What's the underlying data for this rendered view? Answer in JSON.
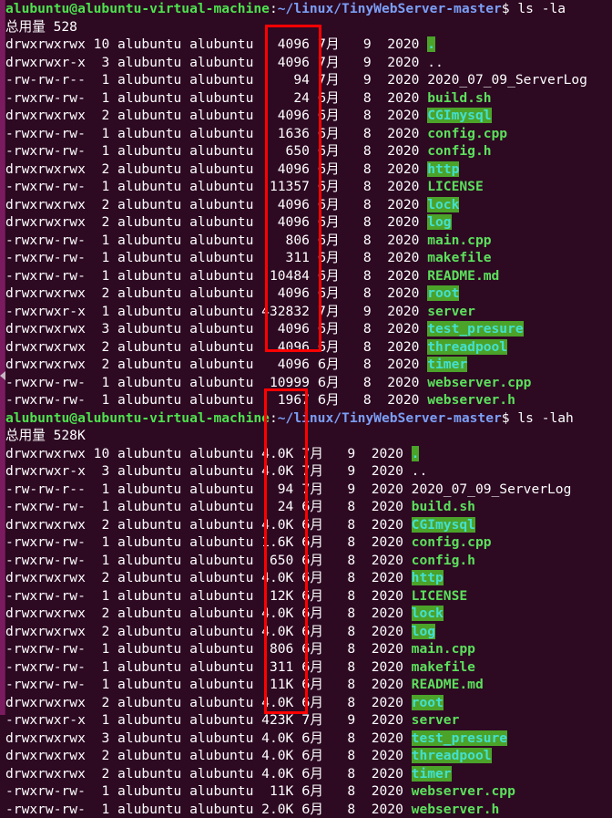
{
  "terminal": {
    "background_color": "#2d0922",
    "prompt": {
      "user_host": "alubuntu@alubuntu-virtual-machine",
      "separator": ":",
      "path": "~/linux/TinyWebServer-master",
      "sigil": "$"
    },
    "colors": {
      "prompt_user": "#4ee24e",
      "prompt_path": "#7b9ff5",
      "directory_fg": "#43e0d0",
      "directory_bg": "#4ba32a",
      "executable": "#5ce05c",
      "source_file": "#5ce05c",
      "plain_text": "#ffffff",
      "annotation_box": "#ff0000"
    },
    "sessions": [
      {
        "command": "ls -la",
        "total_label": "总用量",
        "total_value": "528",
        "rows": [
          {
            "perm": "drwxrwxrwx",
            "links": "10",
            "owner": "alubuntu",
            "group": "alubuntu",
            "size": "4096",
            "month": "7月",
            "day": "9",
            "year": "2020",
            "name": ".",
            "type": "dir"
          },
          {
            "perm": "drwxrwxr-x",
            "links": "3",
            "owner": "alubuntu",
            "group": "alubuntu",
            "size": "4096",
            "month": "7月",
            "day": "9",
            "year": "2020",
            "name": "..",
            "type": "dotdot"
          },
          {
            "perm": "-rw-rw-r--",
            "links": "1",
            "owner": "alubuntu",
            "group": "alubuntu",
            "size": "94",
            "month": "7月",
            "day": "9",
            "year": "2020",
            "name": "2020_07_09_ServerLog",
            "type": "file"
          },
          {
            "perm": "-rwxrw-rw-",
            "links": "1",
            "owner": "alubuntu",
            "group": "alubuntu",
            "size": "24",
            "month": "6月",
            "day": "8",
            "year": "2020",
            "name": "build.sh",
            "type": "src"
          },
          {
            "perm": "drwxrwxrwx",
            "links": "2",
            "owner": "alubuntu",
            "group": "alubuntu",
            "size": "4096",
            "month": "6月",
            "day": "8",
            "year": "2020",
            "name": "CGImysql",
            "type": "dir"
          },
          {
            "perm": "-rwxrw-rw-",
            "links": "1",
            "owner": "alubuntu",
            "group": "alubuntu",
            "size": "1636",
            "month": "6月",
            "day": "8",
            "year": "2020",
            "name": "config.cpp",
            "type": "src"
          },
          {
            "perm": "-rwxrw-rw-",
            "links": "1",
            "owner": "alubuntu",
            "group": "alubuntu",
            "size": "650",
            "month": "6月",
            "day": "8",
            "year": "2020",
            "name": "config.h",
            "type": "src"
          },
          {
            "perm": "drwxrwxrwx",
            "links": "2",
            "owner": "alubuntu",
            "group": "alubuntu",
            "size": "4096",
            "month": "6月",
            "day": "8",
            "year": "2020",
            "name": "http",
            "type": "dir"
          },
          {
            "perm": "-rwxrw-rw-",
            "links": "1",
            "owner": "alubuntu",
            "group": "alubuntu",
            "size": "11357",
            "month": "6月",
            "day": "8",
            "year": "2020",
            "name": "LICENSE",
            "type": "src"
          },
          {
            "perm": "drwxrwxrwx",
            "links": "2",
            "owner": "alubuntu",
            "group": "alubuntu",
            "size": "4096",
            "month": "6月",
            "day": "8",
            "year": "2020",
            "name": "lock",
            "type": "dir"
          },
          {
            "perm": "drwxrwxrwx",
            "links": "2",
            "owner": "alubuntu",
            "group": "alubuntu",
            "size": "4096",
            "month": "6月",
            "day": "8",
            "year": "2020",
            "name": "log",
            "type": "dir"
          },
          {
            "perm": "-rwxrw-rw-",
            "links": "1",
            "owner": "alubuntu",
            "group": "alubuntu",
            "size": "806",
            "month": "6月",
            "day": "8",
            "year": "2020",
            "name": "main.cpp",
            "type": "src"
          },
          {
            "perm": "-rwxrw-rw-",
            "links": "1",
            "owner": "alubuntu",
            "group": "alubuntu",
            "size": "311",
            "month": "6月",
            "day": "8",
            "year": "2020",
            "name": "makefile",
            "type": "src"
          },
          {
            "perm": "-rwxrw-rw-",
            "links": "1",
            "owner": "alubuntu",
            "group": "alubuntu",
            "size": "10484",
            "month": "6月",
            "day": "8",
            "year": "2020",
            "name": "README.md",
            "type": "src"
          },
          {
            "perm": "drwxrwxrwx",
            "links": "2",
            "owner": "alubuntu",
            "group": "alubuntu",
            "size": "4096",
            "month": "6月",
            "day": "8",
            "year": "2020",
            "name": "root",
            "type": "dir"
          },
          {
            "perm": "-rwxrwxr-x",
            "links": "1",
            "owner": "alubuntu",
            "group": "alubuntu",
            "size": "432832",
            "month": "7月",
            "day": "9",
            "year": "2020",
            "name": "server",
            "type": "exec"
          },
          {
            "perm": "drwxrwxrwx",
            "links": "3",
            "owner": "alubuntu",
            "group": "alubuntu",
            "size": "4096",
            "month": "6月",
            "day": "8",
            "year": "2020",
            "name": "test_presure",
            "type": "dir"
          },
          {
            "perm": "drwxrwxrwx",
            "links": "2",
            "owner": "alubuntu",
            "group": "alubuntu",
            "size": "4096",
            "month": "6月",
            "day": "8",
            "year": "2020",
            "name": "threadpool",
            "type": "dir"
          },
          {
            "perm": "drwxrwxrwx",
            "links": "2",
            "owner": "alubuntu",
            "group": "alubuntu",
            "size": "4096",
            "month": "6月",
            "day": "8",
            "year": "2020",
            "name": "timer",
            "type": "dir"
          },
          {
            "perm": "-rwxrw-rw-",
            "links": "1",
            "owner": "alubuntu",
            "group": "alubuntu",
            "size": "10999",
            "month": "6月",
            "day": "8",
            "year": "2020",
            "name": "webserver.cpp",
            "type": "src"
          },
          {
            "perm": "-rwxrw-rw-",
            "links": "1",
            "owner": "alubuntu",
            "group": "alubuntu",
            "size": "1967",
            "month": "6月",
            "day": "8",
            "year": "2020",
            "name": "webserver.h",
            "type": "src"
          }
        ]
      },
      {
        "command": "ls -lah",
        "total_label": "总用量",
        "total_value": "528K",
        "rows": [
          {
            "perm": "drwxrwxrwx",
            "links": "10",
            "owner": "alubuntu",
            "group": "alubuntu",
            "size": "4.0K",
            "month": "7月",
            "day": "9",
            "year": "2020",
            "name": ".",
            "type": "dir"
          },
          {
            "perm": "drwxrwxr-x",
            "links": "3",
            "owner": "alubuntu",
            "group": "alubuntu",
            "size": "4.0K",
            "month": "7月",
            "day": "9",
            "year": "2020",
            "name": "..",
            "type": "dotdot"
          },
          {
            "perm": "-rw-rw-r--",
            "links": "1",
            "owner": "alubuntu",
            "group": "alubuntu",
            "size": "94",
            "month": "7月",
            "day": "9",
            "year": "2020",
            "name": "2020_07_09_ServerLog",
            "type": "file"
          },
          {
            "perm": "-rwxrw-rw-",
            "links": "1",
            "owner": "alubuntu",
            "group": "alubuntu",
            "size": "24",
            "month": "6月",
            "day": "8",
            "year": "2020",
            "name": "build.sh",
            "type": "src"
          },
          {
            "perm": "drwxrwxrwx",
            "links": "2",
            "owner": "alubuntu",
            "group": "alubuntu",
            "size": "4.0K",
            "month": "6月",
            "day": "8",
            "year": "2020",
            "name": "CGImysql",
            "type": "dir"
          },
          {
            "perm": "-rwxrw-rw-",
            "links": "1",
            "owner": "alubuntu",
            "group": "alubuntu",
            "size": "1.6K",
            "month": "6月",
            "day": "8",
            "year": "2020",
            "name": "config.cpp",
            "type": "src"
          },
          {
            "perm": "-rwxrw-rw-",
            "links": "1",
            "owner": "alubuntu",
            "group": "alubuntu",
            "size": "650",
            "month": "6月",
            "day": "8",
            "year": "2020",
            "name": "config.h",
            "type": "src"
          },
          {
            "perm": "drwxrwxrwx",
            "links": "2",
            "owner": "alubuntu",
            "group": "alubuntu",
            "size": "4.0K",
            "month": "6月",
            "day": "8",
            "year": "2020",
            "name": "http",
            "type": "dir"
          },
          {
            "perm": "-rwxrw-rw-",
            "links": "1",
            "owner": "alubuntu",
            "group": "alubuntu",
            "size": "12K",
            "month": "6月",
            "day": "8",
            "year": "2020",
            "name": "LICENSE",
            "type": "src"
          },
          {
            "perm": "drwxrwxrwx",
            "links": "2",
            "owner": "alubuntu",
            "group": "alubuntu",
            "size": "4.0K",
            "month": "6月",
            "day": "8",
            "year": "2020",
            "name": "lock",
            "type": "dir"
          },
          {
            "perm": "drwxrwxrwx",
            "links": "2",
            "owner": "alubuntu",
            "group": "alubuntu",
            "size": "4.0K",
            "month": "6月",
            "day": "8",
            "year": "2020",
            "name": "log",
            "type": "dir"
          },
          {
            "perm": "-rwxrw-rw-",
            "links": "1",
            "owner": "alubuntu",
            "group": "alubuntu",
            "size": "806",
            "month": "6月",
            "day": "8",
            "year": "2020",
            "name": "main.cpp",
            "type": "src"
          },
          {
            "perm": "-rwxrw-rw-",
            "links": "1",
            "owner": "alubuntu",
            "group": "alubuntu",
            "size": "311",
            "month": "6月",
            "day": "8",
            "year": "2020",
            "name": "makefile",
            "type": "src"
          },
          {
            "perm": "-rwxrw-rw-",
            "links": "1",
            "owner": "alubuntu",
            "group": "alubuntu",
            "size": "11K",
            "month": "6月",
            "day": "8",
            "year": "2020",
            "name": "README.md",
            "type": "src"
          },
          {
            "perm": "drwxrwxrwx",
            "links": "2",
            "owner": "alubuntu",
            "group": "alubuntu",
            "size": "4.0K",
            "month": "6月",
            "day": "8",
            "year": "2020",
            "name": "root",
            "type": "dir"
          },
          {
            "perm": "-rwxrwxr-x",
            "links": "1",
            "owner": "alubuntu",
            "group": "alubuntu",
            "size": "423K",
            "month": "7月",
            "day": "9",
            "year": "2020",
            "name": "server",
            "type": "exec"
          },
          {
            "perm": "drwxrwxrwx",
            "links": "3",
            "owner": "alubuntu",
            "group": "alubuntu",
            "size": "4.0K",
            "month": "6月",
            "day": "8",
            "year": "2020",
            "name": "test_presure",
            "type": "dir"
          },
          {
            "perm": "drwxrwxrwx",
            "links": "2",
            "owner": "alubuntu",
            "group": "alubuntu",
            "size": "4.0K",
            "month": "6月",
            "day": "8",
            "year": "2020",
            "name": "threadpool",
            "type": "dir"
          },
          {
            "perm": "drwxrwxrwx",
            "links": "2",
            "owner": "alubuntu",
            "group": "alubuntu",
            "size": "4.0K",
            "month": "6月",
            "day": "8",
            "year": "2020",
            "name": "timer",
            "type": "dir"
          },
          {
            "perm": "-rwxrw-rw-",
            "links": "1",
            "owner": "alubuntu",
            "group": "alubuntu",
            "size": "11K",
            "month": "6月",
            "day": "8",
            "year": "2020",
            "name": "webserver.cpp",
            "type": "src"
          },
          {
            "perm": "-rwxrw-rw-",
            "links": "1",
            "owner": "alubuntu",
            "group": "alubuntu",
            "size": "2.0K",
            "month": "6月",
            "day": "8",
            "year": "2020",
            "name": "webserver.h",
            "type": "src"
          }
        ]
      }
    ],
    "annotations": [
      {
        "label": "size-column-highlight-la",
        "target": "ls -la size column"
      },
      {
        "label": "size-column-highlight-lah",
        "target": "ls -lah size column"
      }
    ]
  }
}
